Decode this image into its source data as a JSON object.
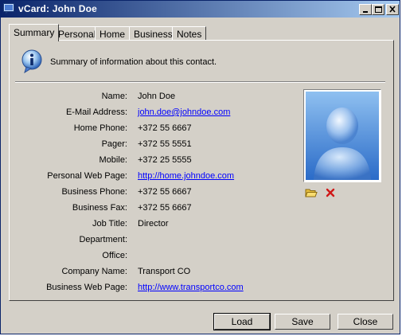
{
  "window": {
    "title": "vCard: John  Doe"
  },
  "tabs": [
    {
      "label": "Summary",
      "active": true
    },
    {
      "label": "Personal"
    },
    {
      "label": "Home"
    },
    {
      "label": "Business"
    },
    {
      "label": "Notes"
    }
  ],
  "summary": {
    "text": "Summary of information about this contact."
  },
  "fields": [
    {
      "label": "Name:",
      "value": "John  Doe"
    },
    {
      "label": "E-Mail Address:",
      "value": "john.doe@johndoe.com",
      "link": true
    },
    {
      "label": "Home Phone:",
      "value": "+372 55 6667"
    },
    {
      "label": "Pager:",
      "value": "+372 55 5551"
    },
    {
      "label": "Mobile:",
      "value": "+372 25 5555"
    },
    {
      "label": "Personal Web Page:",
      "value": "http://home.johndoe.com",
      "link": true
    },
    {
      "label": "Business Phone:",
      "value": "+372 55 6667"
    },
    {
      "label": "Business Fax:",
      "value": "+372 55 6667"
    },
    {
      "label": "Job Title:",
      "value": "Director"
    },
    {
      "label": "Department:",
      "value": ""
    },
    {
      "label": "Office:",
      "value": ""
    },
    {
      "label": "Company Name:",
      "value": "Transport  CO"
    },
    {
      "label": "Business Web Page:",
      "value": "http://www.transportco.com",
      "link": true
    }
  ],
  "buttons": {
    "load": "Load",
    "save": "Save",
    "close": "Close"
  },
  "colors": {
    "title_start": "#0a246a",
    "title_end": "#a6caf0",
    "face": "#d4d0c8",
    "link": "#0000ff"
  }
}
